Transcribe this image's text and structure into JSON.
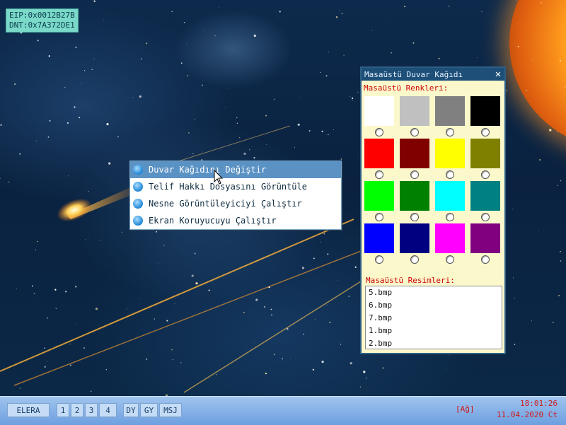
{
  "debug": {
    "eip": "EIP:0x0012B27B",
    "dnt": "DNT:0x7A372DE1"
  },
  "context_menu": {
    "items": [
      {
        "label": "Duvar Kağıdını Değiştir",
        "highlighted": true
      },
      {
        "label": "Telif Hakkı Dosyasını Görüntüle",
        "highlighted": false
      },
      {
        "label": "Nesne Görüntüleyiciyi Çalıştır",
        "highlighted": false
      },
      {
        "label": "Ekran Koruyucuyu Çalıştır",
        "highlighted": false
      }
    ]
  },
  "wallpaper_window": {
    "title": "Masaüstü Duvar Kağıdı",
    "close_icon": "close-icon",
    "colors_label": "Masaüstü Renkleri:",
    "colors": [
      "#ffffff",
      "#c0c0c0",
      "#808080",
      "#000000",
      "#ff0000",
      "#800000",
      "#ffff00",
      "#808000",
      "#00ff00",
      "#008000",
      "#00ffff",
      "#008080",
      "#0000ff",
      "#000080",
      "#ff00ff",
      "#800080"
    ],
    "images_label": "Masaüstü Resimleri:",
    "images": [
      "5.bmp",
      "6.bmp",
      "7.bmp",
      "1.bmp",
      "2.bmp"
    ]
  },
  "taskbar": {
    "start": "ELERA",
    "workspaces": [
      "1",
      "2",
      "3",
      "4"
    ],
    "apps": [
      "DY",
      "GY",
      "MSJ"
    ],
    "network": "[Ağ]",
    "time": "18:01:26",
    "date": "11.04.2020 Ct"
  },
  "colors": {
    "taskbar_text": "#1b3f66",
    "alert_red": "#d0191c",
    "window_title_bg": "#1d4f78",
    "window_bg": "#fbf8cc"
  }
}
